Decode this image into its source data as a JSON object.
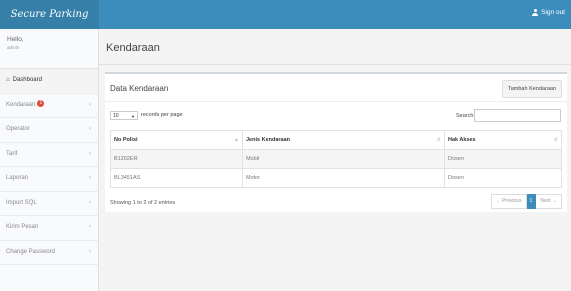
{
  "header": {
    "brand": "Secure Parking",
    "signout": "Sign out"
  },
  "user_panel": {
    "greeting": "Hello,",
    "username": "admin"
  },
  "sidebar": {
    "items": [
      {
        "label": "Dashboard",
        "icon": "home-icon",
        "active": true
      },
      {
        "label": "Kendaraan",
        "badge": "1"
      },
      {
        "label": "Operator"
      },
      {
        "label": "Tarif"
      },
      {
        "label": "Laporan"
      },
      {
        "label": "Import SQL"
      },
      {
        "label": "Kirim Pesan"
      },
      {
        "label": "Change Password"
      }
    ]
  },
  "page": {
    "title": "Kendaraan"
  },
  "box": {
    "title": "Data Kendaraan",
    "add_button": "Tambah Kendaraan",
    "length_value": "10",
    "length_label": "records per page",
    "search_label": "Search:",
    "search_value": ""
  },
  "table": {
    "columns": [
      "No Polisi",
      "Jenis Kendaraan",
      "Hak Akses"
    ],
    "rows": [
      [
        "B1202ER",
        "Mobil",
        "Dosen"
      ],
      [
        "BL3451AS",
        "Motor",
        "Dosen"
      ]
    ]
  },
  "footer": {
    "info": "Showing 1 to 2 of 2 entries",
    "prev": "← Previous",
    "page": "1",
    "next": "Next →"
  },
  "colors": {
    "accent": "#3c8dbc",
    "brand_bg": "#367fa9",
    "badge": "#dd4b39"
  }
}
